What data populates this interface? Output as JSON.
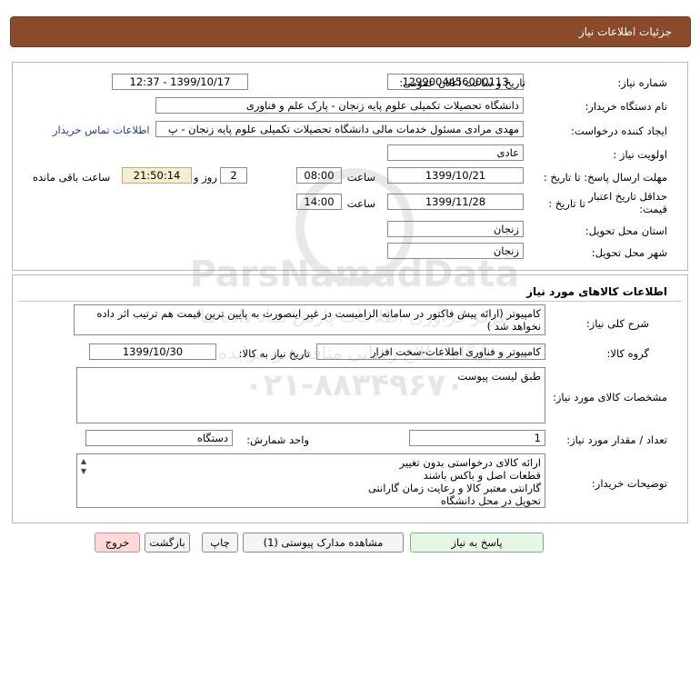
{
  "header": {
    "title": "جزئیات اطلاعات نیاز"
  },
  "info": {
    "need_number_label": "شماره نیاز:",
    "need_number": "1299004456000113",
    "announce_label": "تاریخ و ساعت اعلان عمومی:",
    "announce_value": "1399/10/17 - 12:37",
    "buyer_label": "نام دستگاه خریدار:",
    "buyer_value": "دانشگاه تحصیلات تکمیلی علوم پایه زنجان - پارک علم و فناوری",
    "creator_label": "ایجاد کننده درخواست:",
    "creator_value": "مهدی مرادی مسئول خدمات مالی دانشگاه تحصیلات تکمیلی علوم پایه زنجان - پ",
    "contact_link": "اطلاعات تماس خریدار",
    "priority_label": "اولویت نیاز :",
    "priority_value": "عادی",
    "deadline_label": "مهلت ارسال پاسخ: تا تاریخ :",
    "deadline_date": "1399/10/21",
    "time_label": "ساعت",
    "deadline_time": "08:00",
    "days_value": "2",
    "days_label": "روز و",
    "countdown": "21:50:14",
    "remaining_label": "ساعت باقی مانده",
    "validity_label_1": "حداقل تاریخ اعتبار",
    "validity_label_2": "قیمت:",
    "validity_to_label": "تا تاریخ :",
    "validity_date": "1399/11/28",
    "validity_time_label": "ساعت",
    "validity_time": "14:00",
    "province_label": "استان محل تحویل:",
    "province_value": "زنجان",
    "city_label": "شهر محل تحویل:",
    "city_value": "زنجان"
  },
  "goods": {
    "section_title": "اطلاعات کالاهای مورد نیاز",
    "desc_label": "شرح کلی نیاز:",
    "desc_line1": "کامپیوتر (ارائه پیش فاکتور در سامانه الزامیست در غیر اینصورت به پایین ترین قیمت هم ترتیب اثر داده",
    "desc_line2": "نخواهد شد )",
    "group_label": "گروه کالا:",
    "group_value": "کامپیوتر و فناوری اطلاعات-سخت افزار",
    "need_date_label": "تاریخ نیاز به کالا:",
    "need_date_value": "1399/10/30",
    "specs_label": "مشخصات کالای مورد نیاز:",
    "specs_value": "طبق لیست پیوست",
    "qty_label": "تعداد / مقدار مورد نیاز:",
    "qty_value": "1",
    "unit_label": "واحد شمارش:",
    "unit_value": "دستگاه",
    "notes_label": "توضیحات خریدار:",
    "notes_lines": [
      "ارائه کالای درخواستی بدون تغییر",
      "قطعات اصل و باکس باشند",
      "گارانتی معتبر کالا و رعایت زمان گارانتی",
      "تحویل در محل دانشگاه"
    ]
  },
  "buttons": {
    "reply": "پاسخ به نیاز",
    "attachments": "مشاهده مدارک پیوستی (1)",
    "print": "چاپ",
    "back": "بازگشت",
    "exit": "خروج"
  },
  "watermark": {
    "site": "ParsNamadData",
    "line1": "مرکز فرآوری اطلاعات پارس نماد داده ها",
    "line2": "پایگاه اطلاع رسانی مناقصه و مزایده",
    "phone": "۰۲۱-۸۸۳۴۹۶۷۰"
  }
}
